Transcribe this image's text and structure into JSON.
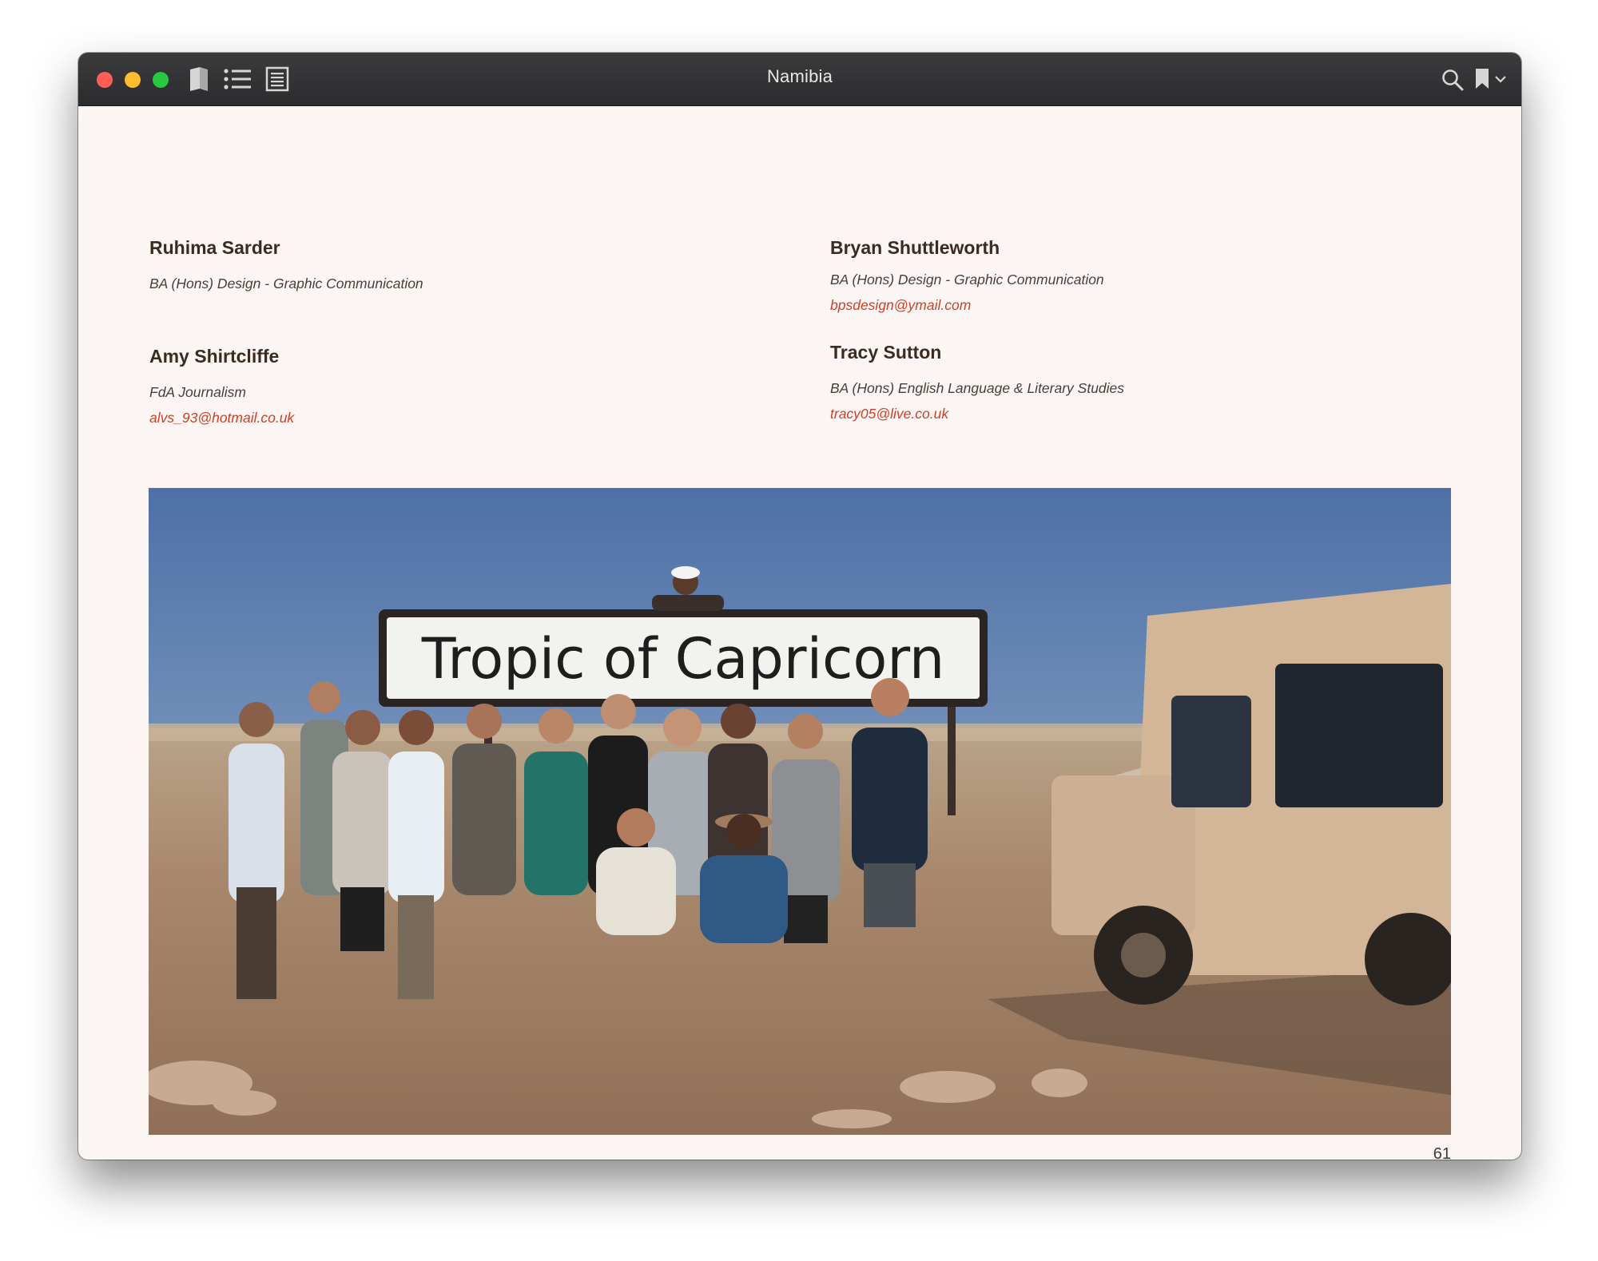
{
  "window": {
    "title": "Namibia"
  },
  "entries": [
    {
      "name": "Ruhima Sarder",
      "program": "BA (Hons) Design - Graphic Communication",
      "email": ""
    },
    {
      "name": "Bryan Shuttleworth",
      "program": "BA (Hons) Design - Graphic Communication",
      "email": "bpsdesign@ymail.com"
    },
    {
      "name": "Amy Shirtcliffe",
      "program": "FdA Journalism",
      "email": "alvs_93@hotmail.co.uk"
    },
    {
      "name": "Tracy Sutton",
      "program": "BA (Hons) English Language & Literary Studies",
      "email": "tracy05@live.co.uk"
    }
  ],
  "photo": {
    "sign_text": "Tropic of Capricorn"
  },
  "page": {
    "number": "61"
  },
  "colors": {
    "accent_link": "#c8402a",
    "name_text": "#3a2a22",
    "page_bg": "#fbf6f3",
    "titlebar": "#2c2c2e"
  },
  "icons": [
    "book-icon",
    "list-icon",
    "page-view-icon",
    "search-icon",
    "bookmark-icon",
    "chevron-down-icon"
  ]
}
